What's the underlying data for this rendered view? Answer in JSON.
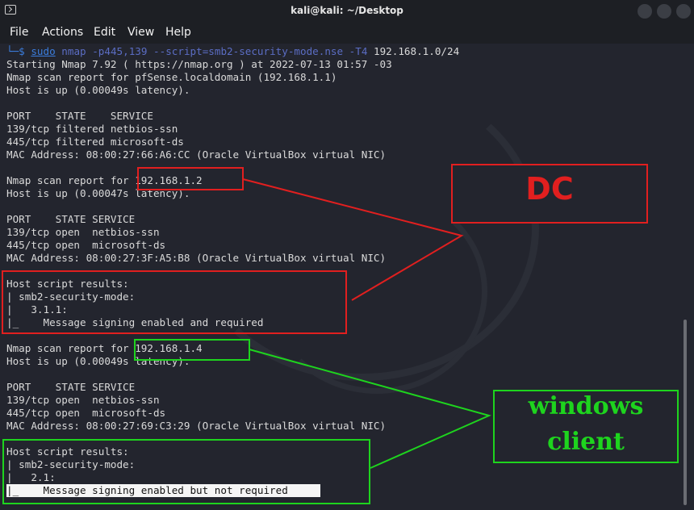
{
  "window": {
    "title": "kali@kali: ~/Desktop"
  },
  "menu": [
    "File",
    "Actions",
    "Edit",
    "View",
    "Help"
  ],
  "terminal": {
    "prompt_glyph": "└─$",
    "cmd_sudo": "sudo",
    "cmd_nmap": "nmap",
    "cmd_args": "-p445,139 --script=smb2-security-mode.nse -T4",
    "cmd_target": "192.168.1.0/24",
    "lines": [
      "Starting Nmap 7.92 ( https://nmap.org ) at 2022-07-13 01:57 -03",
      "Nmap scan report for pfSense.localdomain (192.168.1.1)",
      "Host is up (0.00049s latency).",
      "",
      "PORT    STATE    SERVICE",
      "139/tcp filtered netbios-ssn",
      "445/tcp filtered microsoft-ds",
      "MAC Address: 08:00:27:66:A6:CC (Oracle VirtualBox virtual NIC)",
      "",
      "Nmap scan report for 192.168.1.2",
      "Host is up (0.00047s latency).",
      "",
      "PORT    STATE SERVICE",
      "139/tcp open  netbios-ssn",
      "445/tcp open  microsoft-ds",
      "MAC Address: 08:00:27:3F:A5:B8 (Oracle VirtualBox virtual NIC)",
      "",
      "Host script results:",
      "| smb2-security-mode:",
      "|   3.1.1:",
      "|_    Message signing enabled and required",
      "",
      "Nmap scan report for 192.168.1.4",
      "Host is up (0.00049s latency).",
      "",
      "PORT    STATE SERVICE",
      "139/tcp open  netbios-ssn",
      "445/tcp open  microsoft-ds",
      "MAC Address: 08:00:27:69:C3:29 (Oracle VirtualBox virtual NIC)",
      "",
      "Host script results:",
      "| smb2-security-mode:",
      "|   2.1:",
      "|_    Message signing enabled but not required"
    ]
  },
  "annotations": {
    "dc_label": "DC",
    "windows_label_line1": "windows",
    "windows_label_line2": "client",
    "red_color": "#e11f1f",
    "green_color": "#1ed41e"
  }
}
